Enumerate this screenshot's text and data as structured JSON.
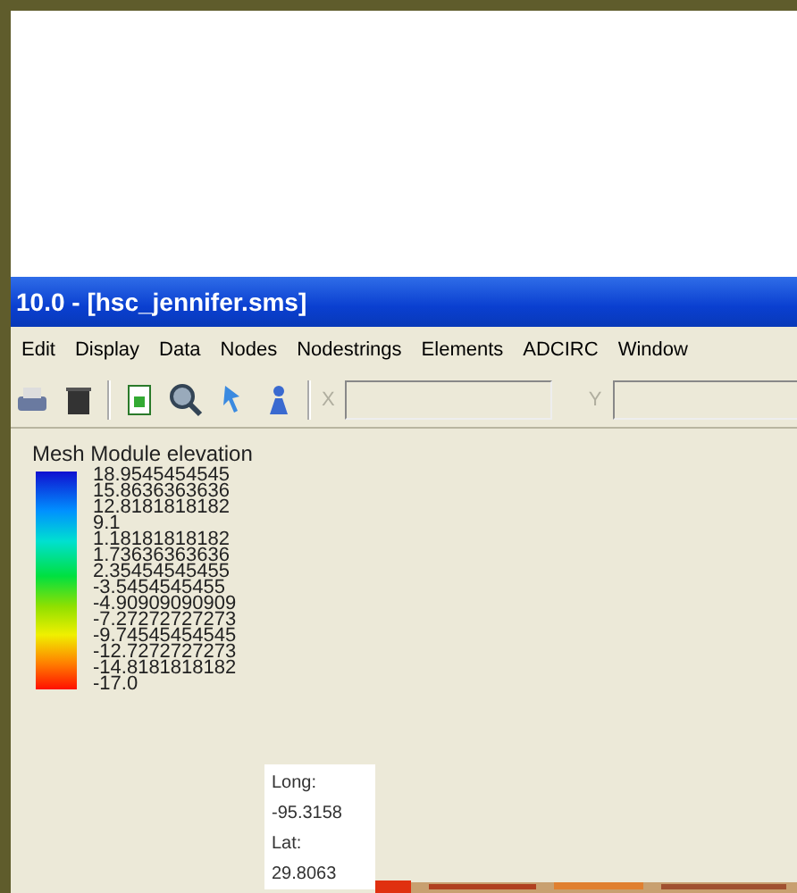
{
  "window": {
    "title": "10.0 - [hsc_jennifer.sms]"
  },
  "menu": [
    "Edit",
    "Display",
    "Data",
    "Nodes",
    "Nodestrings",
    "Elements",
    "ADCIRC",
    "Window"
  ],
  "toolbar": {
    "x_label": "X",
    "y_label": "Y"
  },
  "legend": {
    "title": "Mesh Module elevation",
    "labels": [
      "18.9545454545",
      "15.8636363636",
      "12.8181818182",
      "9.1",
      "1.18181818182",
      "1.73636363636",
      "2.35454545455",
      "-3.5454545455",
      "-4.90909090909",
      "-7.27272727273",
      "-9.74545454545",
      "-12.7272727273",
      "-14.8181818182",
      "-17.0"
    ]
  },
  "coords": {
    "long_label": "Long:",
    "long": "-95.3158",
    "lat_label": "Lat:",
    "lat": "29.8063"
  }
}
